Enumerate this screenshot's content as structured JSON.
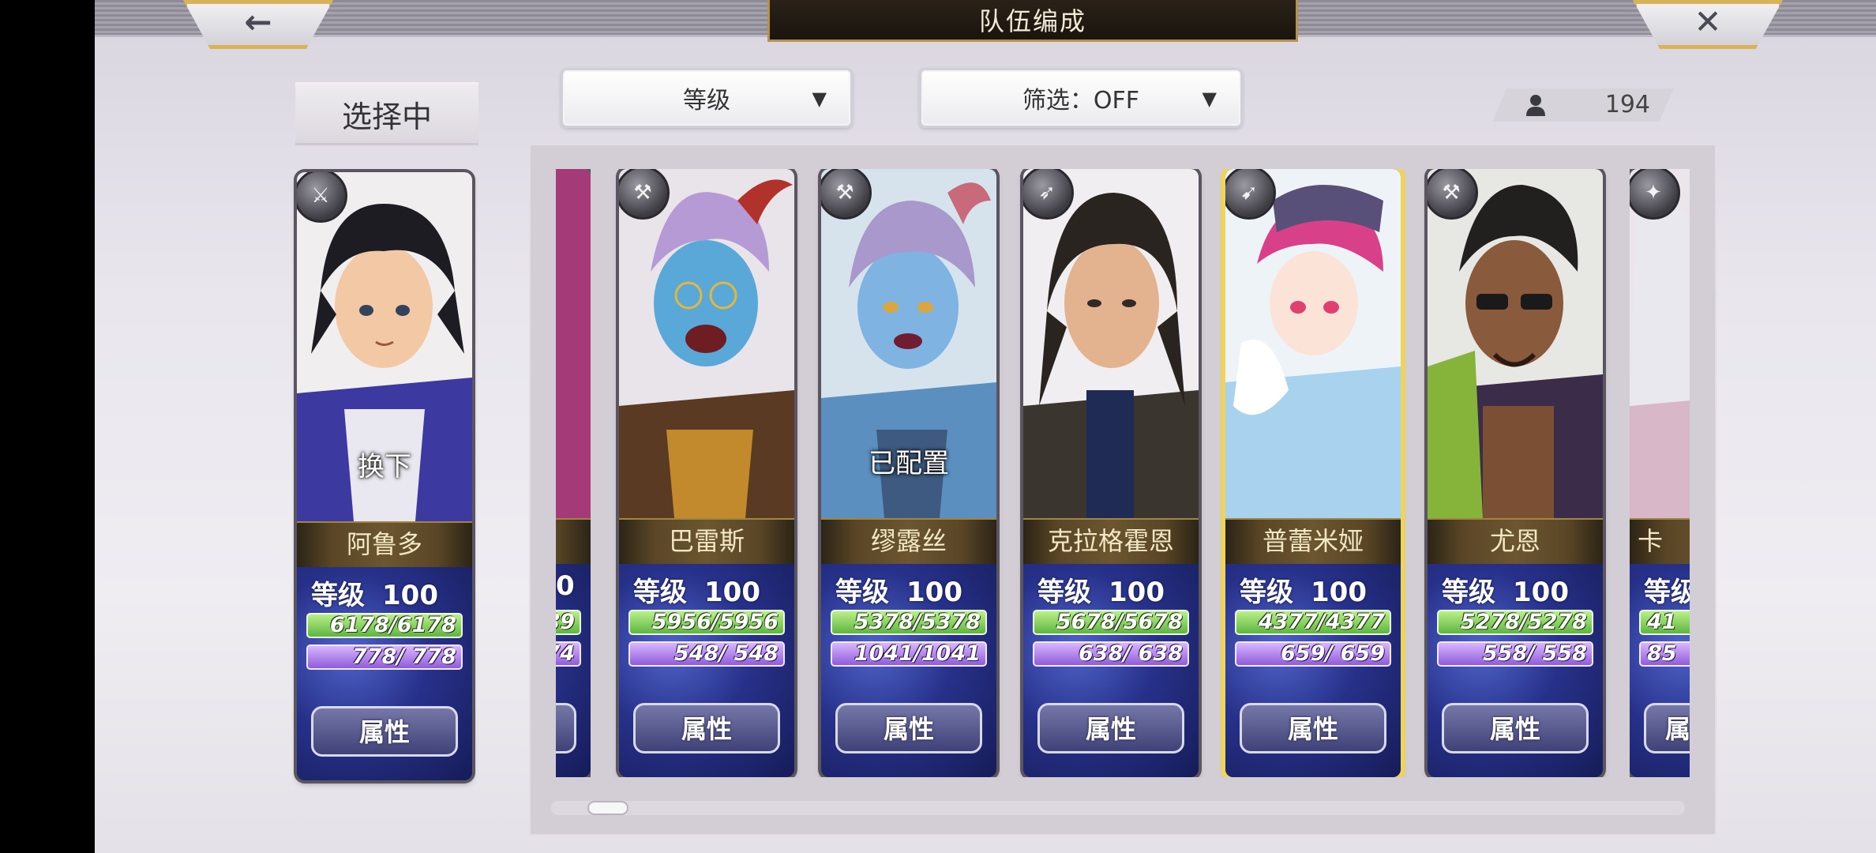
{
  "header": {
    "title": "队伍编成",
    "back_glyph": "←",
    "close_glyph": "✕"
  },
  "selecting_label": "选择中",
  "sort_dropdown": {
    "value": "等级",
    "arrow": "▼"
  },
  "filter_dropdown": {
    "value": "筛选：OFF",
    "arrow": "▼"
  },
  "unit_count": "194",
  "current": {
    "name": "阿鲁多",
    "level_label": "等级",
    "level": "100",
    "hp": "6178/6178",
    "mp": "778/ 778",
    "overlay": "换下",
    "attr_label": "属性",
    "class_icon": "sword-icon"
  },
  "partial_left": {
    "hp": "89",
    "mp": "74",
    "level": "0"
  },
  "units": [
    {
      "name": "巴雷斯",
      "level_label": "等级",
      "level": "100",
      "hp": "5956/5956",
      "mp": "548/ 548",
      "overlay": "",
      "attr_label": "属性",
      "class_icon": "axe-icon",
      "selected": false
    },
    {
      "name": "缪露丝",
      "level_label": "等级",
      "level": "100",
      "hp": "5378/5378",
      "mp": "1041/1041",
      "overlay": "已配置",
      "attr_label": "属性",
      "class_icon": "axe-icon",
      "selected": false
    },
    {
      "name": "克拉格霍恩",
      "level_label": "等级",
      "level": "100",
      "hp": "5678/5678",
      "mp": "638/ 638",
      "overlay": "",
      "attr_label": "属性",
      "class_icon": "spear-icon",
      "selected": false
    },
    {
      "name": "普蕾米娅",
      "level_label": "等级",
      "level": "100",
      "hp": "4377/4377",
      "mp": "659/ 659",
      "overlay": "",
      "attr_label": "属性",
      "class_icon": "bow-icon",
      "selected": true
    },
    {
      "name": "尤恩",
      "level_label": "等级",
      "level": "100",
      "hp": "5278/5278",
      "mp": "558/ 558",
      "overlay": "",
      "attr_label": "属性",
      "class_icon": "hammer-icon",
      "selected": false
    }
  ],
  "partial_right": {
    "name": "卡",
    "level_label": "等级",
    "hp": "41",
    "mp": "85",
    "attr_label": "属",
    "class_icon": "staff-icon"
  },
  "colors": {
    "selected_border": "#ecd45f",
    "hp": "#7fd45a",
    "mp": "#a97ae6",
    "stat_bg": "#27318a"
  }
}
